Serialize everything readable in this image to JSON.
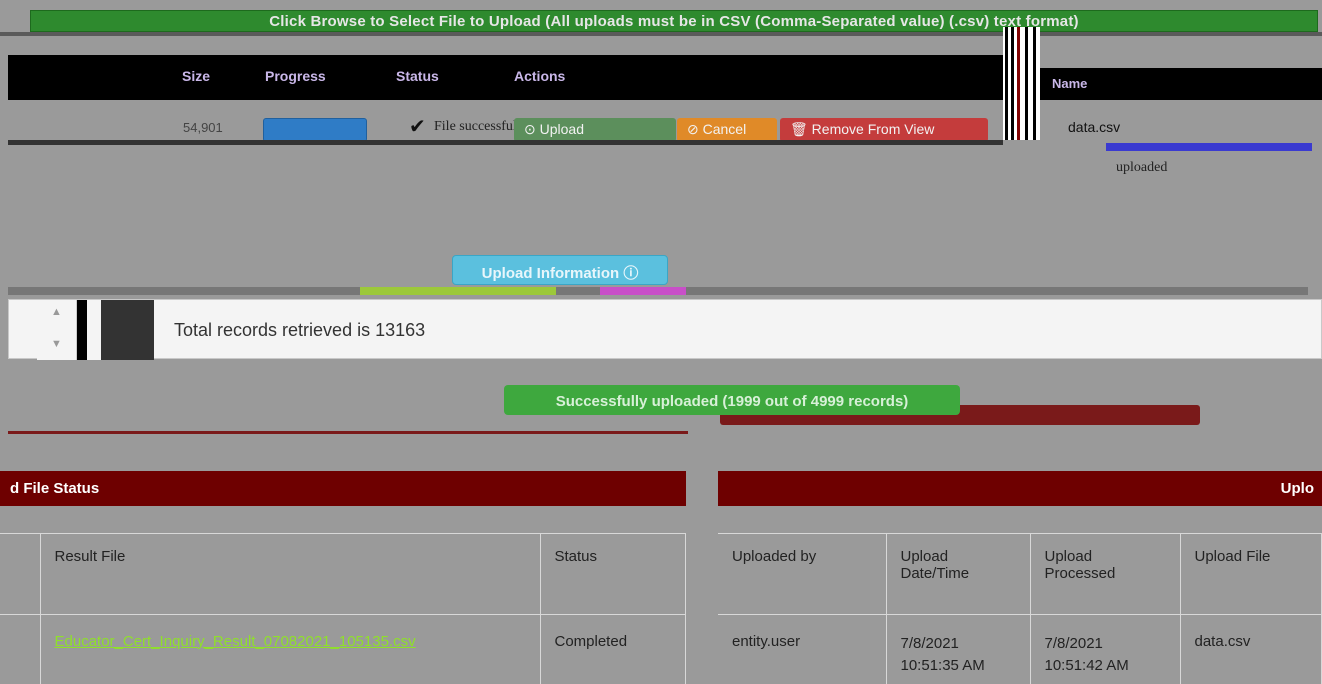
{
  "banner": {
    "instruction": "Click Browse to Select File to Upload (All uploads must be in CSV (Comma-Separated value) (.csv) text format)"
  },
  "upload_queue": {
    "headers": {
      "name": "Name",
      "size": "Size",
      "progress": "Progress",
      "status": "Status",
      "actions": "Actions"
    },
    "file": {
      "name": "data.csv",
      "size": "54,901",
      "status_text": "File successfully uploaded",
      "check_icon": "check-icon",
      "uploaded_note": "uploaded"
    },
    "buttons": {
      "upload": "Upload",
      "cancel": "Cancel",
      "remove": "Remove From View"
    },
    "colors": {
      "browse": "#2f7cc6",
      "upload": "#5c8f5c",
      "cancel": "#e08a28",
      "remove": "#c43c3c",
      "progress": "#3a3ad0"
    }
  },
  "upload_info": {
    "button_label": "Upload Information"
  },
  "records": {
    "text": "Total records retrieved is 13163"
  },
  "success_alert": {
    "text": "Successfully uploaded (1999 out of 4999 records)"
  },
  "file_status_panel": {
    "title": "d File Status",
    "columns": [
      "Result File",
      "Status"
    ],
    "rows": [
      {
        "result_file": "Educator_Cert_Inquiry_Result_07082021_105135.csv",
        "status": "Completed"
      }
    ]
  },
  "upload_panel": {
    "title": "Uplo",
    "columns": [
      "Uploaded by",
      "Upload Date/Time",
      "Upload Processed",
      "Upload File"
    ],
    "rows": [
      {
        "uploaded_by": "entity.user",
        "upload_date": "7/8/2021",
        "upload_time": "10:51:35 AM",
        "processed_date": "7/8/2021",
        "processed_time": "10:51:42 AM",
        "upload_file": "data.csv"
      }
    ]
  },
  "theme": {
    "panel_header": "#6e0000",
    "success": "#3ea83e",
    "info": "#5bc0de",
    "link": "#8fe02a"
  }
}
